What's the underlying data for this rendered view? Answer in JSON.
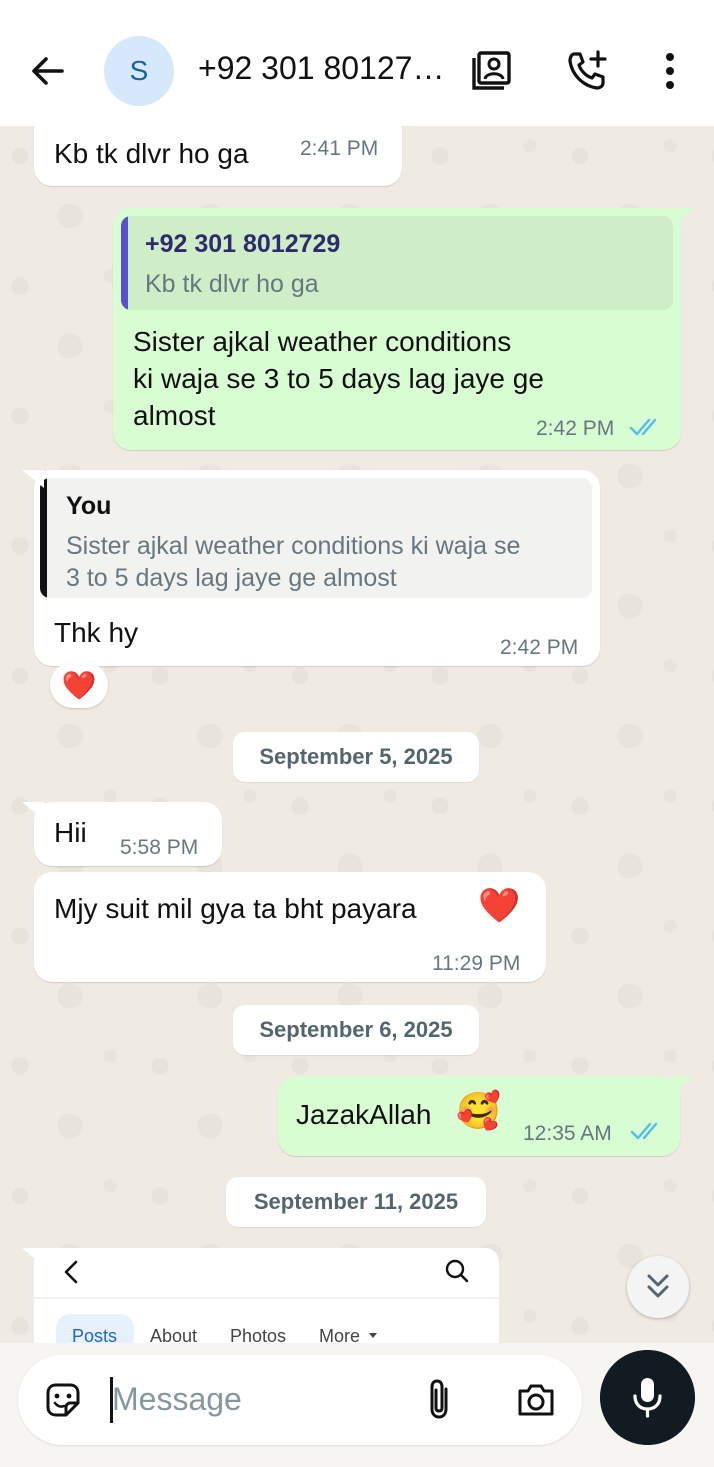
{
  "header": {
    "avatar_letter": "S",
    "contact_title": "+92 301 80127…"
  },
  "messages": {
    "m1": {
      "text": "Kb tk dlvr ho ga",
      "time": "2:41 PM"
    },
    "m2": {
      "quote_name": "+92 301 8012729",
      "quote_text": "Kb tk dlvr ho ga",
      "lines": [
        "Sister ajkal weather conditions",
        "ki waja se 3 to 5 days lag jaye ge",
        "almost"
      ],
      "time": "2:42 PM"
    },
    "m3": {
      "quote_name": "You",
      "quote_lines": [
        "Sister ajkal weather conditions ki waja se",
        "3 to 5 days lag jaye ge almost"
      ],
      "text": "Thk hy",
      "time": "2:42 PM",
      "reaction": "❤️"
    },
    "m4": {
      "text": "Hii",
      "time": "5:58 PM"
    },
    "m5": {
      "text": "Mjy suit mil gya ta bht payara",
      "emoji": "❤️",
      "time": "11:29 PM"
    },
    "m6": {
      "text": "JazakAllah",
      "emoji": "🥰",
      "time": "12:35 AM"
    }
  },
  "dates": {
    "d1": "September 5, 2025",
    "d2": "September 6, 2025",
    "d3": "September 11, 2025"
  },
  "preview": {
    "tabs": [
      "Posts",
      "About",
      "Photos",
      "More"
    ]
  },
  "composer": {
    "placeholder": "Message"
  },
  "colors": {
    "outgoing_bubble": "#d9fdd3",
    "incoming_bubble": "#ffffff",
    "read_ticks": "#53bdeb",
    "quote_bar_contact": "#5b4fcf",
    "quote_bar_you": "#111111"
  },
  "icons": [
    "back-arrow-icon",
    "contact-card-icon",
    "add-call-icon",
    "more-vert-icon",
    "sticker-icon",
    "attach-icon",
    "camera-icon",
    "mic-icon",
    "double-chevron-down-icon",
    "double-check-icon"
  ]
}
